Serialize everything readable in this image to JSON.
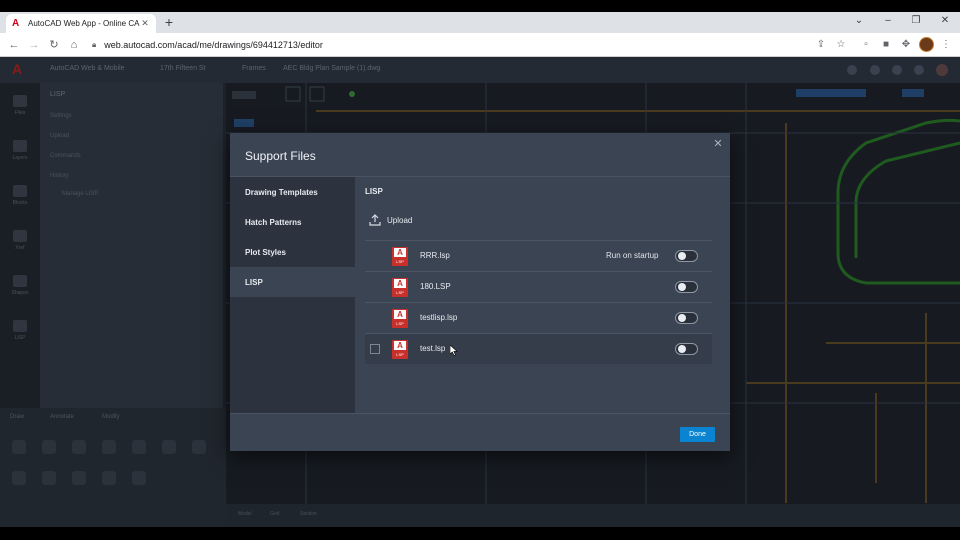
{
  "browser": {
    "tab_title": "AutoCAD Web App - Online CAD",
    "url": "web.autocad.com/acad/me/drawings/694412713/editor"
  },
  "app": {
    "logo": "A",
    "header_crumbs": [
      "AutoCAD Web & Mobile",
      "17th Fifteen St",
      "Frames",
      "AEC Bldg Plan Sample (1).dwg"
    ],
    "rail_labels": [
      "Files",
      "Layers",
      "Blocks",
      "Xref",
      "Shapes",
      "LISP"
    ],
    "left_panel_heading": "LISP",
    "left_panel_items": [
      "Settings",
      "Upload",
      "Commands",
      "History",
      "Manage LISP"
    ],
    "lower_tabs": [
      "Draw",
      "Annotate",
      "Modify"
    ],
    "status_items": [
      "Model",
      "Grid",
      "Section"
    ]
  },
  "modal": {
    "title": "Support Files",
    "nav": [
      {
        "label": "Drawing Templates",
        "active": false
      },
      {
        "label": "Hatch Patterns",
        "active": false
      },
      {
        "label": "Plot Styles",
        "active": false
      },
      {
        "label": "LISP",
        "active": true
      }
    ],
    "section_heading": "LISP",
    "upload_label": "Upload",
    "file_icon_letter": "A",
    "file_icon_tag": "LSP",
    "files": [
      {
        "name": "RRR.lsp",
        "run_on_startup_label": "Run on startup",
        "enabled": false
      },
      {
        "name": "180.LSP",
        "run_on_startup_label": "",
        "enabled": false
      },
      {
        "name": "testlisp.lsp",
        "run_on_startup_label": "",
        "enabled": false
      },
      {
        "name": "test.lsp",
        "run_on_startup_label": "",
        "enabled": false
      }
    ],
    "done_label": "Done"
  },
  "colors": {
    "accent": "#0a84d0",
    "file_icon": "#c8302c",
    "modal_bg": "#3b4453"
  }
}
